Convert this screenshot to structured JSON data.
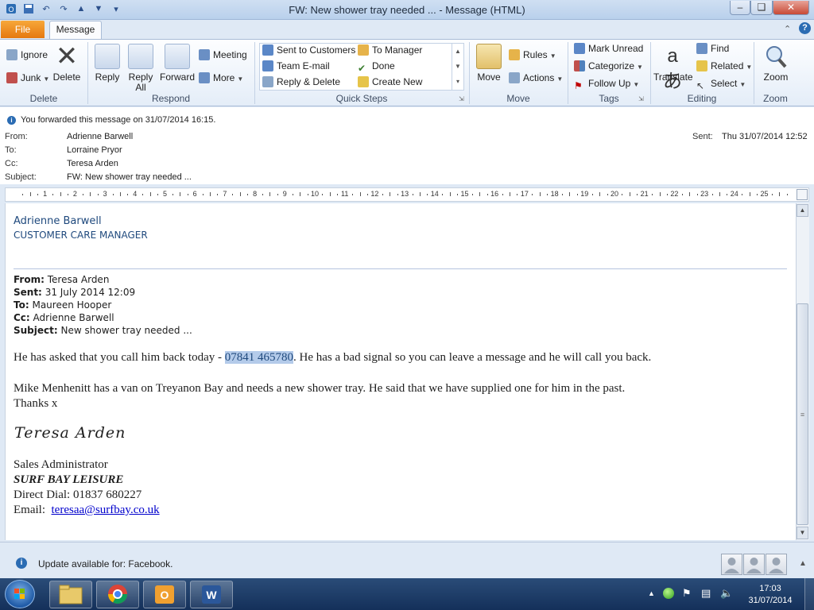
{
  "window": {
    "title": "FW: New shower tray needed ...  -  Message (HTML)"
  },
  "tabs": {
    "file": "File",
    "message": "Message"
  },
  "ribbon": {
    "delete_group": {
      "label": "Delete",
      "ignore": "Ignore",
      "junk": "Junk",
      "delete": "Delete"
    },
    "respond_group": {
      "label": "Respond",
      "reply": "Reply",
      "reply_all_1": "Reply",
      "reply_all_2": "All",
      "forward": "Forward",
      "meeting": "Meeting",
      "more": "More"
    },
    "quick_steps_group": {
      "label": "Quick Steps",
      "items": [
        "Sent to Customers",
        "To Manager",
        "Team E-mail",
        "Done",
        "Reply & Delete",
        "Create New"
      ]
    },
    "move_group": {
      "label": "Move",
      "move": "Move",
      "rules": "Rules",
      "actions": "Actions"
    },
    "tags_group": {
      "label": "Tags",
      "mark_unread": "Mark Unread",
      "categorize": "Categorize",
      "follow_up": "Follow Up"
    },
    "editing_group": {
      "label": "Editing",
      "translate": "Translate",
      "find": "Find",
      "related": "Related",
      "select": "Select"
    },
    "zoom_group": {
      "label": "Zoom",
      "zoom": "Zoom"
    }
  },
  "header": {
    "info": "You forwarded this message on 31/07/2014 16:15.",
    "from_label": "From:",
    "from": "Adrienne Barwell",
    "to_label": "To:",
    "to": "Lorraine Pryor",
    "cc_label": "Cc:",
    "cc": "Teresa Arden",
    "subject_label": "Subject:",
    "subject": "FW: New shower tray needed ...",
    "sent_label": "Sent:",
    "sent": "Thu 31/07/2014 12:52"
  },
  "ruler": {
    "numbers": [
      "1",
      "2",
      "3",
      "4",
      "5",
      "6",
      "7",
      "8",
      "9",
      "10",
      "11",
      "12",
      "13",
      "14",
      "15",
      "16",
      "17",
      "18",
      "19",
      "20",
      "21",
      "22",
      "23",
      "24",
      "25"
    ]
  },
  "body": {
    "sig_name": "Adrienne Barwell",
    "sig_title": "CUSTOMER CARE MANAGER",
    "fwd_from_label": "From:",
    "fwd_from": "Teresa Arden",
    "fwd_sent_label": "Sent:",
    "fwd_sent": "31 July 2014 12:09",
    "fwd_to_label": "To:",
    "fwd_to": "Maureen Hooper",
    "fwd_cc_label": "Cc:",
    "fwd_cc": "Adrienne Barwell",
    "fwd_subject_label": "Subject:",
    "fwd_subject": "New shower tray needed ...",
    "para1_a": "He has asked that you call him back today - ",
    "para1_phone": "07841 465780",
    "para1_b": ".  He has a bad signal so you can leave a message and he will call you back.",
    "para2": "Mike Menhenitt has a van on Treyanon Bay and needs a new shower tray.  He said that we have supplied one for him in the past.",
    "thanks": "Thanks x",
    "signature_script": "Teresa Arden",
    "role": "Sales Administrator",
    "company": "SURF BAY LEISURE",
    "direct_dial": "Direct Dial:  01837 680227",
    "email_label": "Email:  ",
    "email": "teresaa@surfbay.co.uk"
  },
  "status": {
    "update_text": "Update available for: Facebook."
  },
  "taskbar": {
    "time": "17:03",
    "date": "31/07/2014"
  },
  "colors": {
    "accent": "#2b579a",
    "file_tab": "#e5780f",
    "highlight": "#b4cbea",
    "link": "#0000cc",
    "signature_blue": "#1f497d"
  }
}
